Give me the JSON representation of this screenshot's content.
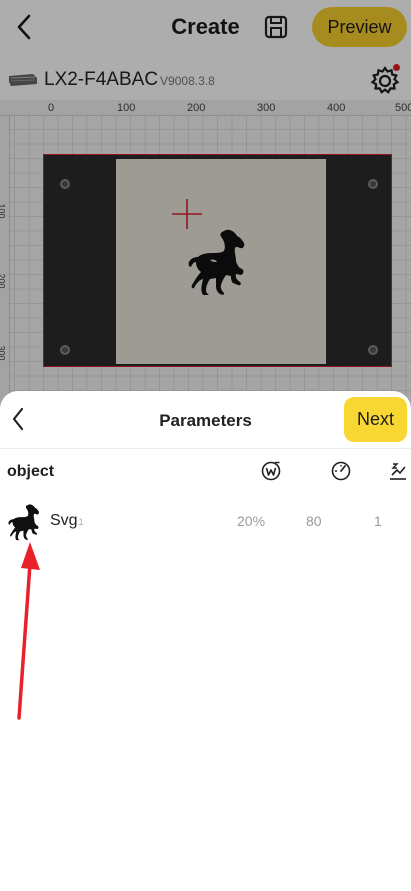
{
  "header": {
    "title": "Create",
    "preview_label": "Preview",
    "icons": {
      "back": "back-chevron-icon",
      "save": "save-icon"
    }
  },
  "device": {
    "name": "LX2-F4ABAC",
    "version": "V9008.3.8",
    "icons": {
      "device": "laser-device-icon",
      "settings": "settings-gear-icon"
    },
    "notification_color": "#e02020"
  },
  "canvas": {
    "ruler_x_labels": [
      "0",
      "100",
      "200",
      "300",
      "400",
      "500"
    ],
    "ruler_y_labels": [
      "100",
      "200",
      "300"
    ],
    "bed_border_color": "#d8212d",
    "design": "horse-svg-design"
  },
  "parameters_sheet": {
    "title": "Parameters",
    "next_label": "Next",
    "columns": {
      "object_label": "object",
      "icons": [
        "power-w-icon",
        "speed-gauge-icon",
        "passes-icon"
      ]
    },
    "rows": [
      {
        "thumbnail": "horse-thumbnail-icon",
        "name": "Svg",
        "suffix": "1",
        "power": "20%",
        "speed": "80",
        "passes": "1"
      }
    ]
  },
  "annotation": {
    "arrow_color": "#e8212b"
  },
  "colors": {
    "accent_yellow": "#f5cf2e"
  }
}
